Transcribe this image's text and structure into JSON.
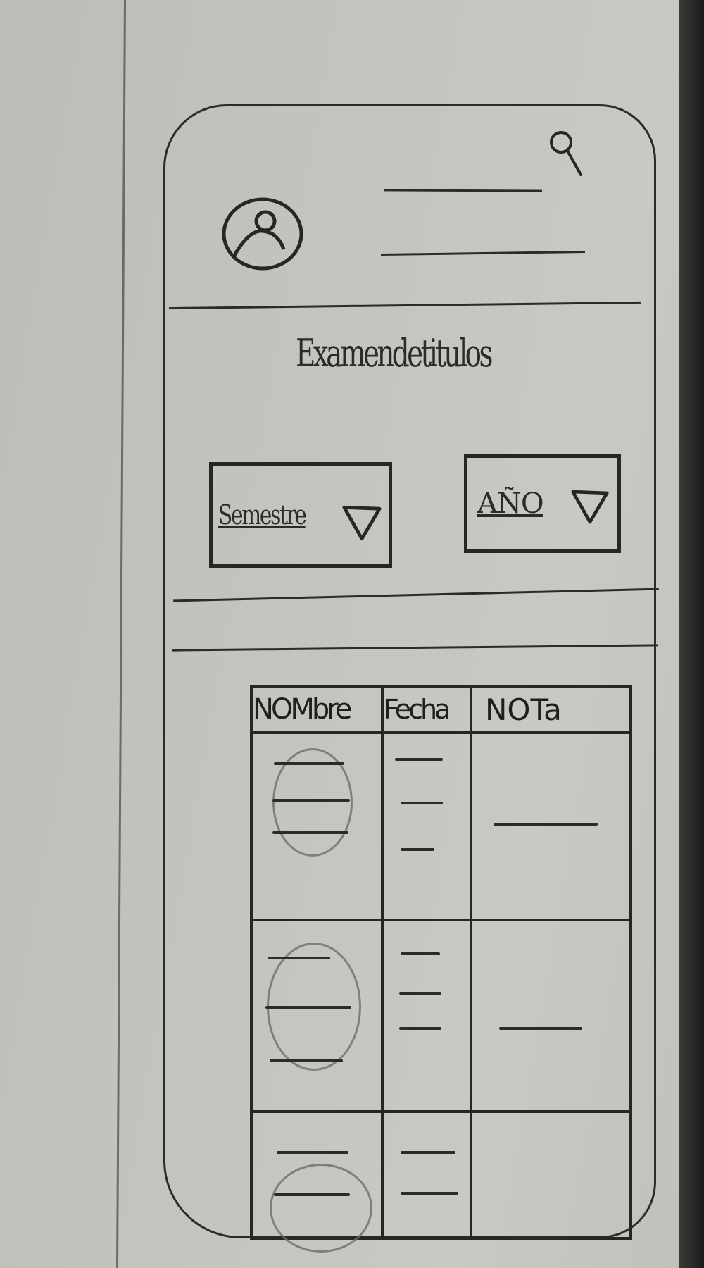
{
  "header": {
    "avatar_icon": "user-avatar-icon",
    "search_icon": "search-icon"
  },
  "main": {
    "title": "Examendetitulos"
  },
  "filters": {
    "semestre_label": "Semestre",
    "anio_label": "AÑO",
    "dropdown_icon": "triangle-down-icon"
  },
  "table": {
    "columns": [
      "NOMbre",
      "Fecha",
      "NOTa"
    ]
  }
}
